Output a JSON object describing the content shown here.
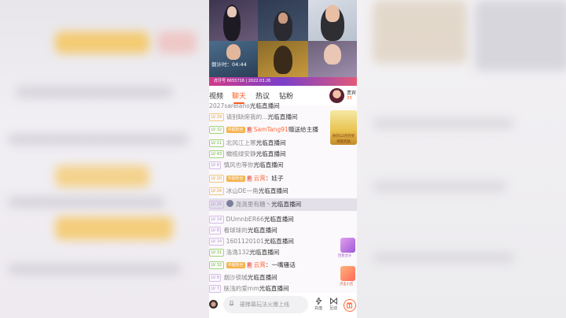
{
  "stream": {
    "timer_label": "倒计时：04:44",
    "ticker": "虎牙号 6655716 | 2022.03.26"
  },
  "tabs": [
    {
      "label": "视频",
      "active": false
    },
    {
      "label": "聊天",
      "active": true
    },
    {
      "label": "热议",
      "active": false
    },
    {
      "label": "钻粉",
      "active": false
    }
  ],
  "anchor": {
    "name": "贵宾",
    "count": "35"
  },
  "chat": {
    "items": [
      {
        "level": "",
        "user": "2027sarelano",
        "message": "光临直播间"
      },
      {
        "level": "LV 29",
        "user": "请别缺席我的...",
        "message": "光临直播间"
      },
      {
        "level": "LV 32",
        "fan_badge": "中超粉丝",
        "noble_badge": "爵",
        "user": "SamTang91",
        "message": "赠送给主播"
      },
      {
        "level": "LV 11",
        "user": "北风江上寒",
        "message": "光临直播间"
      },
      {
        "level": "LV 43",
        "user": "橄榄绿安静",
        "message": "光临直播间"
      },
      {
        "level": "LV 6",
        "user": "慎风也等你",
        "message": "光临直播间"
      },
      {
        "level": "LV 20",
        "fan_badge": "中超粉丝",
        "noble_badge": "爵",
        "user": "云霄",
        "message": "：娃子"
      },
      {
        "level": "LV 24",
        "user": "冰山DE一角",
        "message": "光临直播间"
      },
      {
        "level": "LV 25",
        "user": "尧尧里有糖丶",
        "message": "光临直播间"
      },
      {
        "level": "LV 14",
        "user": "DUmnbER66",
        "message": "光临直播间"
      },
      {
        "level": "LV 8",
        "user": "看球球的",
        "message": "光临直播间"
      },
      {
        "level": "LV 14",
        "user": "1601120101",
        "message": "光临直播间"
      },
      {
        "level": "LV 31",
        "user": "洛逸132",
        "message": "光临直播间"
      },
      {
        "level": "LV 32",
        "fan_badge": "中超粉丝",
        "noble_badge": "爵",
        "user": "云霄",
        "message": "：一嘴骚话"
      },
      {
        "level": "LV 8",
        "user": "烟沙锁城",
        "message": "光临直播间"
      },
      {
        "level": "LV 7",
        "user": "肤浅的爱mm",
        "message": "光临直播间"
      }
    ]
  },
  "ads": {
    "promo_banner": "你的12月开奖",
    "promo_button": "领取奖励",
    "side_ad_1": "回看虎牙",
    "side_ad_2": "点击小店"
  },
  "bottom_bar": {
    "input_placeholder": "硬撑幕玩法火爆上线",
    "recharge_label": "充值",
    "interact_label": "互动"
  },
  "colors": {
    "accent": "#ff5a1f",
    "gift_name": "#ff6a3a",
    "highlight_row": "#e3e0ea"
  }
}
